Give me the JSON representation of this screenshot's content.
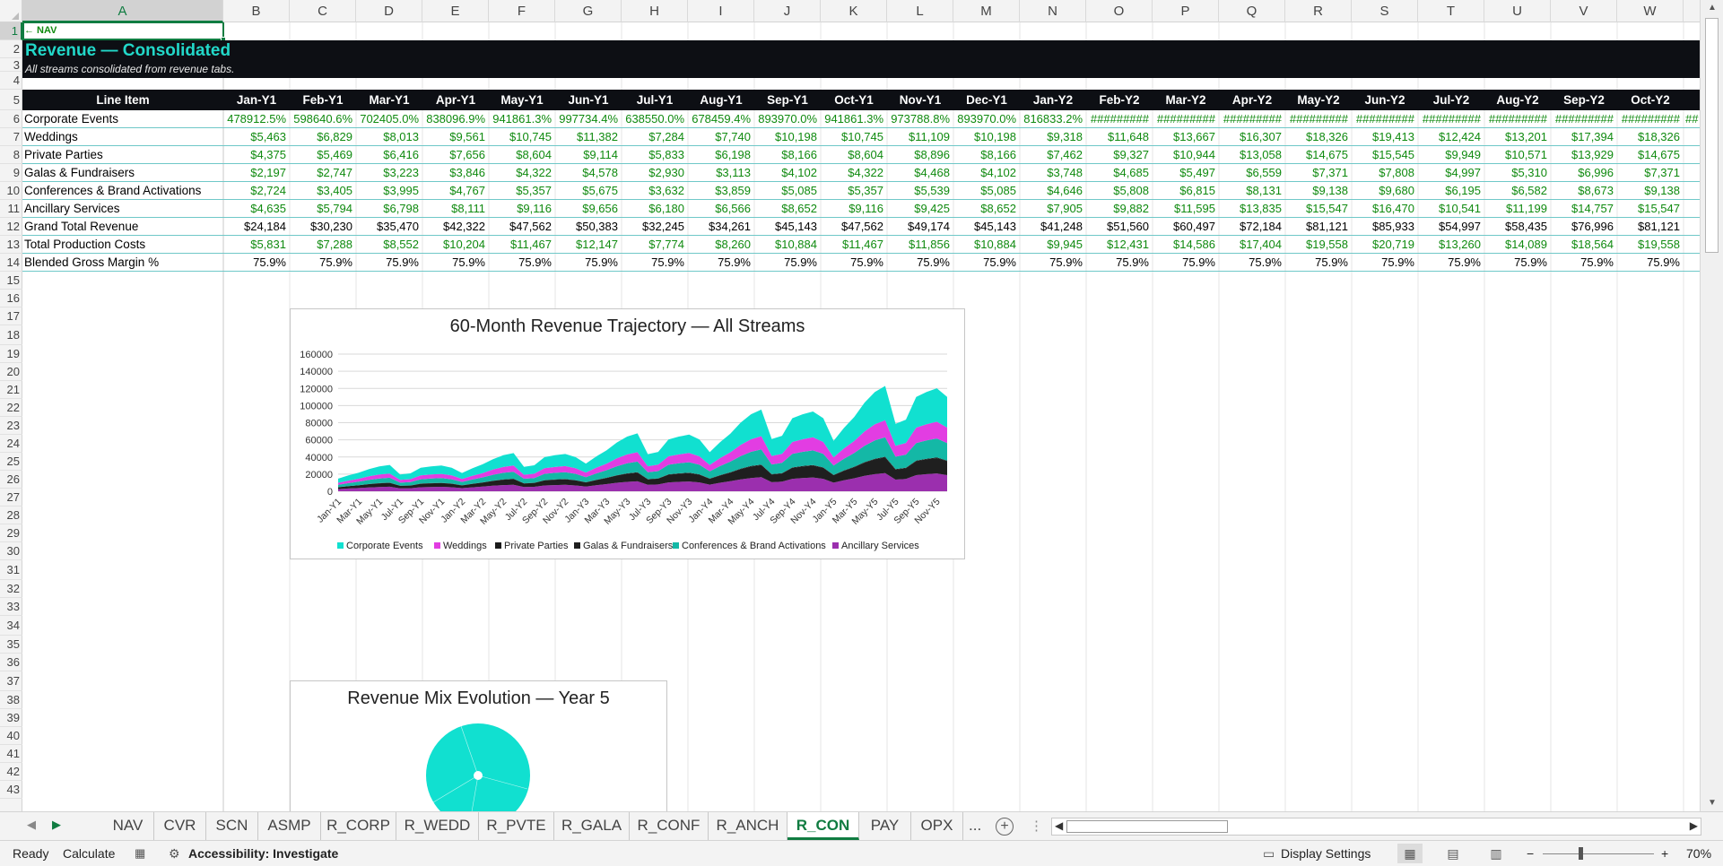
{
  "columns": [
    "A",
    "B",
    "C",
    "D",
    "E",
    "F",
    "G",
    "H",
    "I",
    "J",
    "K",
    "L",
    "M",
    "N",
    "O",
    "P",
    "Q",
    "R",
    "S",
    "T",
    "U",
    "V",
    "W"
  ],
  "selected_column": "A",
  "selected_row": "1",
  "rows": [
    "1",
    "2",
    "3",
    "4",
    "5",
    "6",
    "7",
    "8",
    "9",
    "10",
    "11",
    "12",
    "13",
    "14",
    "15",
    "16",
    "17",
    "18",
    "19",
    "20",
    "21",
    "22",
    "23",
    "24",
    "25",
    "26",
    "27",
    "28",
    "29",
    "30",
    "31",
    "32",
    "33",
    "34",
    "35",
    "36",
    "37",
    "38",
    "39",
    "40",
    "41",
    "42",
    "43"
  ],
  "sheet": {
    "nav_link": "← NAV",
    "title": "Revenue — Consolidated",
    "subtitle": "All streams consolidated from revenue tabs.",
    "header_label": "Line Item",
    "months": [
      "Jan-Y1",
      "Feb-Y1",
      "Mar-Y1",
      "Apr-Y1",
      "May-Y1",
      "Jun-Y1",
      "Jul-Y1",
      "Aug-Y1",
      "Sep-Y1",
      "Oct-Y1",
      "Nov-Y1",
      "Dec-Y1",
      "Jan-Y2",
      "Feb-Y2",
      "Mar-Y2",
      "Apr-Y2",
      "May-Y2",
      "Jun-Y2",
      "Jul-Y2",
      "Aug-Y2",
      "Sep-Y2",
      "Oct-Y2"
    ],
    "line_items": [
      {
        "label": "Corporate Events",
        "color": "green",
        "values": [
          "478912.5%",
          "598640.6%",
          "702405.0%",
          "838096.9%",
          "941861.3%",
          "997734.4%",
          "638550.0%",
          "678459.4%",
          "893970.0%",
          "941861.3%",
          "973788.8%",
          "893970.0%",
          "816833.2%",
          "#########",
          "#########",
          "#########",
          "#########",
          "#########",
          "#########",
          "#########",
          "#########",
          "#########",
          "##"
        ]
      },
      {
        "label": "Weddings",
        "color": "green",
        "values": [
          "$5,463",
          "$6,829",
          "$8,013",
          "$9,561",
          "$10,745",
          "$11,382",
          "$7,284",
          "$7,740",
          "$10,198",
          "$10,745",
          "$11,109",
          "$10,198",
          "$9,318",
          "$11,648",
          "$13,667",
          "$16,307",
          "$18,326",
          "$19,413",
          "$12,424",
          "$13,201",
          "$17,394",
          "$18,326"
        ]
      },
      {
        "label": "Private Parties",
        "color": "green",
        "values": [
          "$4,375",
          "$5,469",
          "$6,416",
          "$7,656",
          "$8,604",
          "$9,114",
          "$5,833",
          "$6,198",
          "$8,166",
          "$8,604",
          "$8,896",
          "$8,166",
          "$7,462",
          "$9,327",
          "$10,944",
          "$13,058",
          "$14,675",
          "$15,545",
          "$9,949",
          "$10,571",
          "$13,929",
          "$14,675"
        ]
      },
      {
        "label": "Galas & Fundraisers",
        "color": "green",
        "values": [
          "$2,197",
          "$2,747",
          "$3,223",
          "$3,846",
          "$4,322",
          "$4,578",
          "$2,930",
          "$3,113",
          "$4,102",
          "$4,322",
          "$4,468",
          "$4,102",
          "$3,748",
          "$4,685",
          "$5,497",
          "$6,559",
          "$7,371",
          "$7,808",
          "$4,997",
          "$5,310",
          "$6,996",
          "$7,371"
        ]
      },
      {
        "label": "Conferences & Brand Activations",
        "color": "green",
        "values": [
          "$2,724",
          "$3,405",
          "$3,995",
          "$4,767",
          "$5,357",
          "$5,675",
          "$3,632",
          "$3,859",
          "$5,085",
          "$5,357",
          "$5,539",
          "$5,085",
          "$4,646",
          "$5,808",
          "$6,815",
          "$8,131",
          "$9,138",
          "$9,680",
          "$6,195",
          "$6,582",
          "$8,673",
          "$9,138"
        ]
      },
      {
        "label": "Ancillary Services",
        "color": "green",
        "values": [
          "$4,635",
          "$5,794",
          "$6,798",
          "$8,111",
          "$9,116",
          "$9,656",
          "$6,180",
          "$6,566",
          "$8,652",
          "$9,116",
          "$9,425",
          "$8,652",
          "$7,905",
          "$9,882",
          "$11,595",
          "$13,835",
          "$15,547",
          "$16,470",
          "$10,541",
          "$11,199",
          "$14,757",
          "$15,547"
        ]
      },
      {
        "label": "Grand Total Revenue",
        "color": "black",
        "values": [
          "$24,184",
          "$30,230",
          "$35,470",
          "$42,322",
          "$47,562",
          "$50,383",
          "$32,245",
          "$34,261",
          "$45,143",
          "$47,562",
          "$49,174",
          "$45,143",
          "$41,248",
          "$51,560",
          "$60,497",
          "$72,184",
          "$81,121",
          "$85,933",
          "$54,997",
          "$58,435",
          "$76,996",
          "$81,121"
        ]
      },
      {
        "label": "Total Production Costs",
        "color": "green",
        "values": [
          "$5,831",
          "$7,288",
          "$8,552",
          "$10,204",
          "$11,467",
          "$12,147",
          "$7,774",
          "$8,260",
          "$10,884",
          "$11,467",
          "$11,856",
          "$10,884",
          "$9,945",
          "$12,431",
          "$14,586",
          "$17,404",
          "$19,558",
          "$20,719",
          "$13,260",
          "$14,089",
          "$18,564",
          "$19,558"
        ]
      },
      {
        "label": "Blended Gross Margin %",
        "color": "black",
        "values": [
          "75.9%",
          "75.9%",
          "75.9%",
          "75.9%",
          "75.9%",
          "75.9%",
          "75.9%",
          "75.9%",
          "75.9%",
          "75.9%",
          "75.9%",
          "75.9%",
          "75.9%",
          "75.9%",
          "75.9%",
          "75.9%",
          "75.9%",
          "75.9%",
          "75.9%",
          "75.9%",
          "75.9%",
          "75.9%"
        ]
      }
    ]
  },
  "chart_data": [
    {
      "type": "area",
      "stacked": true,
      "title": "60-Month Revenue Trajectory — All Streams",
      "ylim": [
        0,
        160000
      ],
      "yticks": [
        "160000",
        "140000",
        "120000",
        "100000",
        "80000",
        "60000",
        "40000",
        "20000",
        "0"
      ],
      "x_tick_labels": [
        "Jan-Y1",
        "Mar-Y1",
        "May-Y1",
        "Jul-Y1",
        "Sep-Y1",
        "Nov-Y1",
        "Jan-Y2",
        "Mar-Y2",
        "May-Y2",
        "Jul-Y2",
        "Sep-Y2",
        "Nov-Y2",
        "Jan-Y3",
        "Mar-Y3",
        "May-Y3",
        "Jul-Y3",
        "Sep-Y3",
        "Nov-Y3",
        "Jan-Y4",
        "Mar-Y4",
        "May-Y4",
        "Jul-Y4",
        "Sep-Y4",
        "Nov-Y4",
        "Jan-Y5",
        "Mar-Y5",
        "May-Y5",
        "Jul-Y5",
        "Sep-Y5",
        "Nov-Y5"
      ],
      "legend_position": "bottom",
      "series": [
        {
          "name": "Ancillary Services",
          "color": "#9b2fae",
          "y1": [
            2500,
            3200,
            3800,
            4500,
            5000,
            5300,
            3400,
            3600,
            4700,
            5000,
            5200,
            4700
          ],
          "growth": [
            1.0,
            1.45,
            2.2,
            3.1,
            4.0
          ]
        },
        {
          "name": "Galas & Fundraisers",
          "color": "#1f1f1f",
          "y1": [
            2197,
            2747,
            3223,
            3846,
            4322,
            4578,
            2930,
            3113,
            4102,
            4322,
            4468,
            4102
          ],
          "growth": [
            1.0,
            1.45,
            2.2,
            3.1,
            4.0
          ]
        },
        {
          "name": "Private Parties",
          "color": "#1a1a1a",
          "y1": [
            100,
            120,
            140,
            160,
            180,
            190,
            120,
            130,
            170,
            180,
            185,
            170
          ],
          "growth": [
            1.0,
            1.45,
            2.2,
            3.1,
            4.0
          ]
        },
        {
          "name": "Conferences & Brand Activations",
          "color": "#14b8a6",
          "y1": [
            2724,
            3405,
            3995,
            4767,
            5357,
            5675,
            3632,
            3859,
            5085,
            5357,
            5539,
            5085
          ],
          "growth": [
            1.0,
            1.45,
            2.2,
            3.1,
            4.0
          ]
        },
        {
          "name": "Weddings",
          "color": "#e23de2",
          "y1": [
            2400,
            3000,
            3500,
            4200,
            4700,
            5000,
            3200,
            3400,
            4500,
            4700,
            4900,
            4500
          ],
          "growth": [
            1.0,
            1.45,
            2.2,
            3.1,
            4.0
          ]
        },
        {
          "name": "Corporate Events",
          "color": "#11e0d0",
          "y1": [
            4789,
            5986,
            7024,
            8381,
            9419,
            9977,
            6386,
            6785,
            8940,
            9419,
            9738,
            8940
          ],
          "growth": [
            1.0,
            1.45,
            2.2,
            3.1,
            4.0
          ]
        }
      ],
      "legend": [
        "Corporate Events",
        "Weddings",
        "Private Parties",
        "Galas & Fundraisers",
        "Conferences & Brand Activations",
        "Ancillary Services"
      ],
      "legend_colors": [
        "#11e0d0",
        "#e23de2",
        "#1a1a1a",
        "#1f1f1f",
        "#14b8a6",
        "#9b2fae"
      ]
    },
    {
      "type": "pie",
      "title": "Revenue Mix Evolution — Year 5",
      "color": "#11e0d0"
    }
  ],
  "tabs": [
    "NAV",
    "CVR",
    "SCN",
    "ASMP",
    "R_CORP",
    "R_WEDD",
    "R_PVTE",
    "R_GALA",
    "R_CONF",
    "R_ANCH",
    "R_CON",
    "PAY",
    "OPX"
  ],
  "active_tab": "R_CON",
  "tabs_more": "...",
  "statusbar": {
    "ready": "Ready",
    "calculate": "Calculate",
    "accessibility": "Accessibility: Investigate",
    "display_settings": "Display Settings",
    "zoom": "70%"
  }
}
